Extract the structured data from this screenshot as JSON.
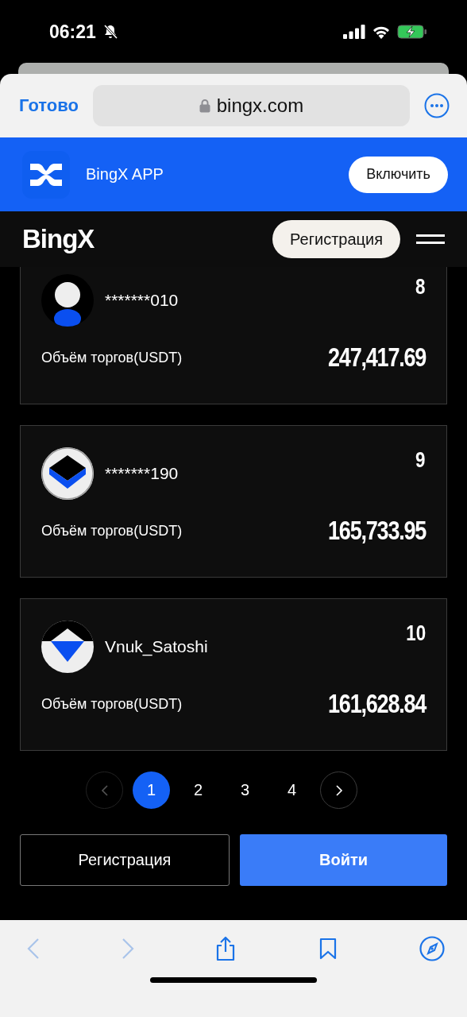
{
  "status_bar": {
    "time": "06:21",
    "silent": true,
    "charging": true
  },
  "browser": {
    "done": "Готово",
    "address": "bingx.com"
  },
  "app_banner": {
    "name": "BingX APP",
    "button": "Включить"
  },
  "header": {
    "logo": "BingX",
    "register": "Регистрация"
  },
  "rankings": [
    {
      "rank": "8",
      "kind": "person",
      "name": "*******010",
      "volume_label": "Объём торгов(USDT)",
      "volume": "247,417.69"
    },
    {
      "rank": "9",
      "kind": "cube",
      "name": "*******190",
      "volume_label": "Объём торгов(USDT)",
      "volume": "165,733.95"
    },
    {
      "rank": "10",
      "kind": "diamond",
      "name": "Vnuk_Satoshi",
      "volume_label": "Объём торгов(USDT)",
      "volume": "161,628.84"
    }
  ],
  "pagination": {
    "pages": [
      {
        "label": "1",
        "selected": true
      },
      {
        "label": "2",
        "selected": false
      },
      {
        "label": "3",
        "selected": false
      },
      {
        "label": "4",
        "selected": false
      }
    ],
    "prev_disabled": true,
    "next_disabled": false
  },
  "actions": {
    "register": "Регистрация",
    "login": "Войти"
  },
  "toolbar": {
    "back_disabled": true,
    "forward_disabled": true
  }
}
